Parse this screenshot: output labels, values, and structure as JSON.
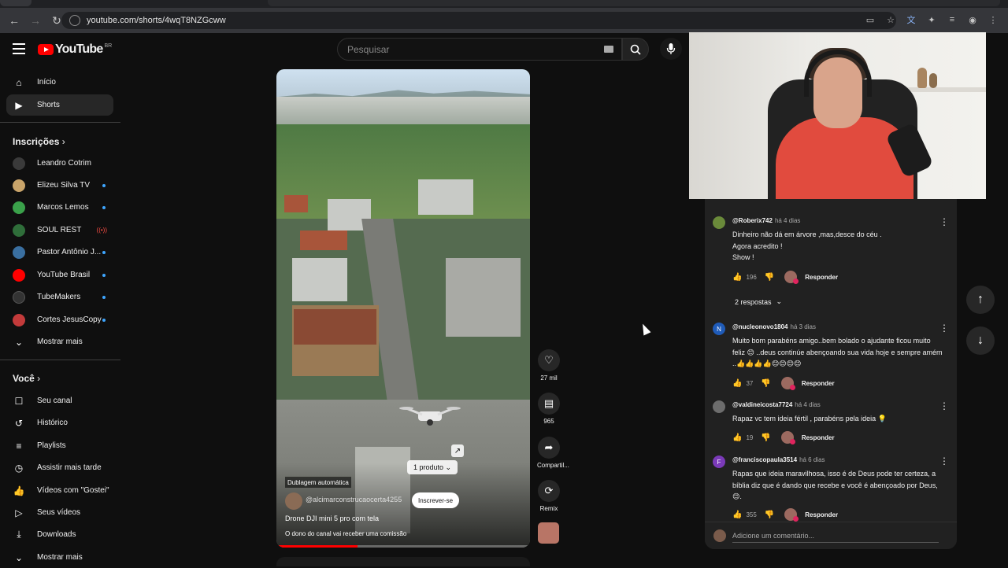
{
  "browser": {
    "url": "youtube.com/shorts/4wqT8NZGcww"
  },
  "header": {
    "logo_text": "YouTube",
    "region": "BR",
    "search_placeholder": "Pesquisar"
  },
  "sidebar": {
    "main": [
      {
        "label": "Início",
        "icon": "home-icon"
      },
      {
        "label": "Shorts",
        "icon": "shorts-icon",
        "active": true
      }
    ],
    "subs_heading": "Inscrições",
    "subs": [
      {
        "label": "Leandro Cotrim",
        "color": "#3a3a3a"
      },
      {
        "label": "Elizeu Silva TV",
        "color": "#c9a46a",
        "new": true
      },
      {
        "label": "Marcos Lemos",
        "color": "#3aa14a",
        "new": true
      },
      {
        "label": "SOUL REST",
        "color": "#2f6e3a",
        "live": true
      },
      {
        "label": "Pastor Antônio J...",
        "color": "#3a6fa0",
        "new": true
      },
      {
        "label": "YouTube Brasil",
        "color": "#ff0000",
        "new": true
      },
      {
        "label": "TubeMakers",
        "color": "#333333",
        "new": true
      },
      {
        "label": "Cortes JesusCopy",
        "color": "#c23a3a",
        "new": true
      }
    ],
    "show_more": "Mostrar mais",
    "you_heading": "Você",
    "you": [
      {
        "label": "Seu canal",
        "icon": "channel-icon"
      },
      {
        "label": "Histórico",
        "icon": "history-icon"
      },
      {
        "label": "Playlists",
        "icon": "playlists-icon"
      },
      {
        "label": "Assistir mais tarde",
        "icon": "watch-later-icon"
      },
      {
        "label": "Vídeos com \"Gostei\"",
        "icon": "liked-icon"
      },
      {
        "label": "Seus vídeos",
        "icon": "your-videos-icon"
      },
      {
        "label": "Downloads",
        "icon": "downloads-icon"
      }
    ],
    "show_more_2": "Mostrar mais"
  },
  "short": {
    "product_label": "1 produto",
    "dub_label": "Dublagem automática",
    "channel": "@alcimarconstrucaocerta4255",
    "subscribe": "Inscrever-se",
    "caption": "Drone DJI mini 5 pro com tela",
    "commission": "O dono do canal vai receber uma comissão",
    "progress": 0.32
  },
  "actions": {
    "likes": "27 mil",
    "comments": "965",
    "share": "Compartil...",
    "remix": "Remix"
  },
  "comments": {
    "items": [
      {
        "user": "@Roberix742",
        "time": "há 4 dias",
        "text": "Dinheiro não dá em árvore ,mas,desce do céu .\nAgora acredito !\nShow !",
        "likes": "196",
        "avatar_color": "#6a8a3a",
        "avatar_letter": ""
      },
      {
        "user": "@nucleonovo1804",
        "time": "há 3 dias",
        "text": "Muito bom parabéns amigo..bem bolado o ajudante ficou muito feliz 😊 ..deus continúe abençoando sua vida hoje e sempre amém ..👍👍👍👍😊😊😊😊",
        "likes": "37",
        "avatar_color": "#1f5bb8",
        "avatar_letter": "N"
      },
      {
        "user": "@valdineicosta7724",
        "time": "há 4 dias",
        "text": "Rapaz vc tem ideia fértil , parabéns pela ideia 💡",
        "likes": "19",
        "avatar_color": "#6d6d6d",
        "avatar_letter": ""
      },
      {
        "user": "@franciscopaula3514",
        "time": "há 6 dias",
        "text": "Rapas que ideia maravilhosa, isso é de Deus pode ter certeza,  a bíblia diz que é dando que recebe e você é abençoado por Deus, 😊.",
        "likes": "355",
        "avatar_color": "#7a3ab8",
        "avatar_letter": "F"
      }
    ],
    "replies_label": "2 respostas",
    "reply_label": "Responder",
    "add_placeholder": "Adicione um comentário..."
  }
}
